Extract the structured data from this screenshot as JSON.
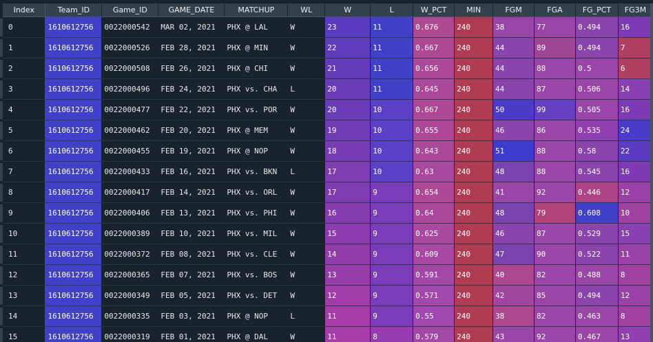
{
  "columns": [
    "Index",
    "Team_ID",
    "Game_ID",
    "GAME_DATE",
    "MATCHUP",
    "WL",
    "W",
    "L",
    "W_PCT",
    "MIN",
    "FGM",
    "FGA",
    "FG_PCT",
    "FG3M"
  ],
  "rows": [
    [
      "0",
      "1610612756",
      "0022000542",
      "MAR 02, 2021",
      "PHX @ LAL",
      "W",
      "23",
      "11",
      "0.676",
      "240",
      "38",
      "77",
      "0.494",
      "16"
    ],
    [
      "1",
      "1610612756",
      "0022000526",
      "FEB 28, 2021",
      "PHX @ MIN",
      "W",
      "22",
      "11",
      "0.667",
      "240",
      "44",
      "89",
      "0.494",
      "7"
    ],
    [
      "2",
      "1610612756",
      "0022000508",
      "FEB 26, 2021",
      "PHX @ CHI",
      "W",
      "21",
      "11",
      "0.656",
      "240",
      "44",
      "88",
      "0.5",
      "6"
    ],
    [
      "3",
      "1610612756",
      "0022000496",
      "FEB 24, 2021",
      "PHX vs. CHA",
      "L",
      "20",
      "11",
      "0.645",
      "240",
      "44",
      "87",
      "0.506",
      "14"
    ],
    [
      "4",
      "1610612756",
      "0022000477",
      "FEB 22, 2021",
      "PHX vs. POR",
      "W",
      "20",
      "10",
      "0.667",
      "240",
      "50",
      "99",
      "0.505",
      "16"
    ],
    [
      "5",
      "1610612756",
      "0022000462",
      "FEB 20, 2021",
      "PHX @ MEM",
      "W",
      "19",
      "10",
      "0.655",
      "240",
      "46",
      "86",
      "0.535",
      "24"
    ],
    [
      "6",
      "1610612756",
      "0022000455",
      "FEB 19, 2021",
      "PHX @ NOP",
      "W",
      "18",
      "10",
      "0.643",
      "240",
      "51",
      "88",
      "0.58",
      "22"
    ],
    [
      "7",
      "1610612756",
      "0022000433",
      "FEB 16, 2021",
      "PHX vs. BKN",
      "L",
      "17",
      "10",
      "0.63",
      "240",
      "48",
      "88",
      "0.545",
      "16"
    ],
    [
      "8",
      "1610612756",
      "0022000417",
      "FEB 14, 2021",
      "PHX vs. ORL",
      "W",
      "17",
      "9",
      "0.654",
      "240",
      "41",
      "92",
      "0.446",
      "12"
    ],
    [
      "9",
      "1610612756",
      "0022000406",
      "FEB 13, 2021",
      "PHX vs. PHI",
      "W",
      "16",
      "9",
      "0.64",
      "240",
      "48",
      "79",
      "0.608",
      "10"
    ],
    [
      "10",
      "1610612756",
      "0022000389",
      "FEB 10, 2021",
      "PHX vs. MIL",
      "W",
      "15",
      "9",
      "0.625",
      "240",
      "46",
      "87",
      "0.529",
      "15"
    ],
    [
      "11",
      "1610612756",
      "0022000372",
      "FEB 08, 2021",
      "PHX vs. CLE",
      "W",
      "14",
      "9",
      "0.609",
      "240",
      "47",
      "90",
      "0.522",
      "11"
    ],
    [
      "12",
      "1610612756",
      "0022000365",
      "FEB 07, 2021",
      "PHX vs. BOS",
      "W",
      "13",
      "9",
      "0.591",
      "240",
      "40",
      "82",
      "0.488",
      "8"
    ],
    [
      "13",
      "1610612756",
      "0022000349",
      "FEB 05, 2021",
      "PHX vs. DET",
      "W",
      "12",
      "9",
      "0.571",
      "240",
      "42",
      "85",
      "0.494",
      "12"
    ],
    [
      "14",
      "1610612756",
      "0022000335",
      "FEB 03, 2021",
      "PHX @ NOP",
      "L",
      "11",
      "9",
      "0.55",
      "240",
      "38",
      "82",
      "0.463",
      "8"
    ],
    [
      "15",
      "1610612756",
      "0022000319",
      "FEB 01, 2021",
      "PHX @ DAL",
      "W",
      "11",
      "8",
      "0.579",
      "240",
      "43",
      "92",
      "0.467",
      "13"
    ]
  ],
  "cell_colors": [
    [
      null,
      "#4040c8",
      null,
      null,
      null,
      null,
      "#5a3cc0",
      "#4040c8",
      "#b04a90",
      "#b03c54",
      "#9a45a8",
      "#9a45a8",
      "#8a44ac",
      "#7e3ab4"
    ],
    [
      null,
      "#4040c8",
      null,
      null,
      null,
      null,
      "#5e3cbc",
      "#4040c8",
      "#ae4894",
      "#b03c54",
      "#8a44ac",
      "#a04494",
      "#8a44ac",
      "#b03f62"
    ],
    [
      null,
      "#4040c8",
      null,
      null,
      null,
      null,
      "#643cba",
      "#4040c8",
      "#ac4896",
      "#b03c54",
      "#8a44ac",
      "#9a45a8",
      "#9a45a8",
      "#b03f62"
    ],
    [
      null,
      "#4040c8",
      null,
      null,
      null,
      null,
      "#6a3cb8",
      "#4040c8",
      "#aa489a",
      "#b03c54",
      "#8a44ac",
      "#9a45a8",
      "#9a45a8",
      "#8a40b0"
    ],
    [
      null,
      "#4040c8",
      null,
      null,
      null,
      null,
      "#6a3cb8",
      "#5a40c4",
      "#ae4894",
      "#b03c54",
      "#4a3cc8",
      "#6440c0",
      "#9a45a8",
      "#7e3ab4"
    ],
    [
      null,
      "#4040c8",
      null,
      null,
      null,
      null,
      "#703cb6",
      "#5a40c4",
      "#ac4896",
      "#b03c54",
      "#8a44ac",
      "#9a45a8",
      "#9040b0",
      "#4a3cc8"
    ],
    [
      null,
      "#4040c8",
      null,
      null,
      null,
      null,
      "#783cb4",
      "#5a40c4",
      "#aa489a",
      "#b03c54",
      "#3c3cd0",
      "#9a45a8",
      "#8a44ac",
      "#5a3cc0"
    ],
    [
      null,
      "#4040c8",
      null,
      null,
      null,
      null,
      "#7e3cb2",
      "#5a40c4",
      "#a8489e",
      "#b03c54",
      "#7a44b0",
      "#9a45a8",
      "#8a44ac",
      "#7e3ab4"
    ],
    [
      null,
      "#4040c8",
      null,
      null,
      null,
      null,
      "#7e3cb2",
      "#7a3cb8",
      "#ac4896",
      "#b03c54",
      "#9a45a8",
      "#9a45a8",
      "#ae4486",
      "#9a40a8"
    ],
    [
      null,
      "#4040c8",
      null,
      null,
      null,
      null,
      "#863cb0",
      "#7a3cb8",
      "#aa489a",
      "#b03c54",
      "#7a44b0",
      "#b04478",
      "#4040c8",
      "#a040a0"
    ],
    [
      null,
      "#4040c8",
      null,
      null,
      null,
      null,
      "#8c3cae",
      "#7a3cb8",
      "#a848a0",
      "#b03c54",
      "#8a44ac",
      "#9a45a8",
      "#8a44ac",
      "#8a40b0"
    ],
    [
      null,
      "#4040c8",
      null,
      null,
      null,
      null,
      "#923cac",
      "#7a3cb8",
      "#a648a4",
      "#b03c54",
      "#7a44b0",
      "#9a45a8",
      "#8a44ac",
      "#9a40a8"
    ],
    [
      null,
      "#4040c8",
      null,
      null,
      null,
      null,
      "#983caa",
      "#7a3cb8",
      "#a448a8",
      "#b03c54",
      "#ac4890",
      "#9a45a8",
      "#9a45a8",
      "#a040a0"
    ],
    [
      null,
      "#4040c8",
      null,
      null,
      null,
      null,
      "#a03ca8",
      "#7a3cb8",
      "#a248ac",
      "#b03c54",
      "#a045a0",
      "#9a45a8",
      "#8a44ac",
      "#9a40a8"
    ],
    [
      null,
      "#4040c8",
      null,
      null,
      null,
      null,
      "#a63ca8",
      "#7a3cb8",
      "#a048b0",
      "#b03c54",
      "#ac4890",
      "#9a45a8",
      "#9a45a8",
      "#a040a0"
    ],
    [
      null,
      "#4040c8",
      null,
      null,
      null,
      null,
      "#a63ca8",
      "#943cb0",
      "#a448a8",
      "#b03c54",
      "#9a45a8",
      "#9a45a8",
      "#9a45a8",
      "#9040b0"
    ]
  ],
  "theme": {
    "background": "#19232d",
    "header_bg": "#32414b",
    "gridline": "#455364"
  }
}
